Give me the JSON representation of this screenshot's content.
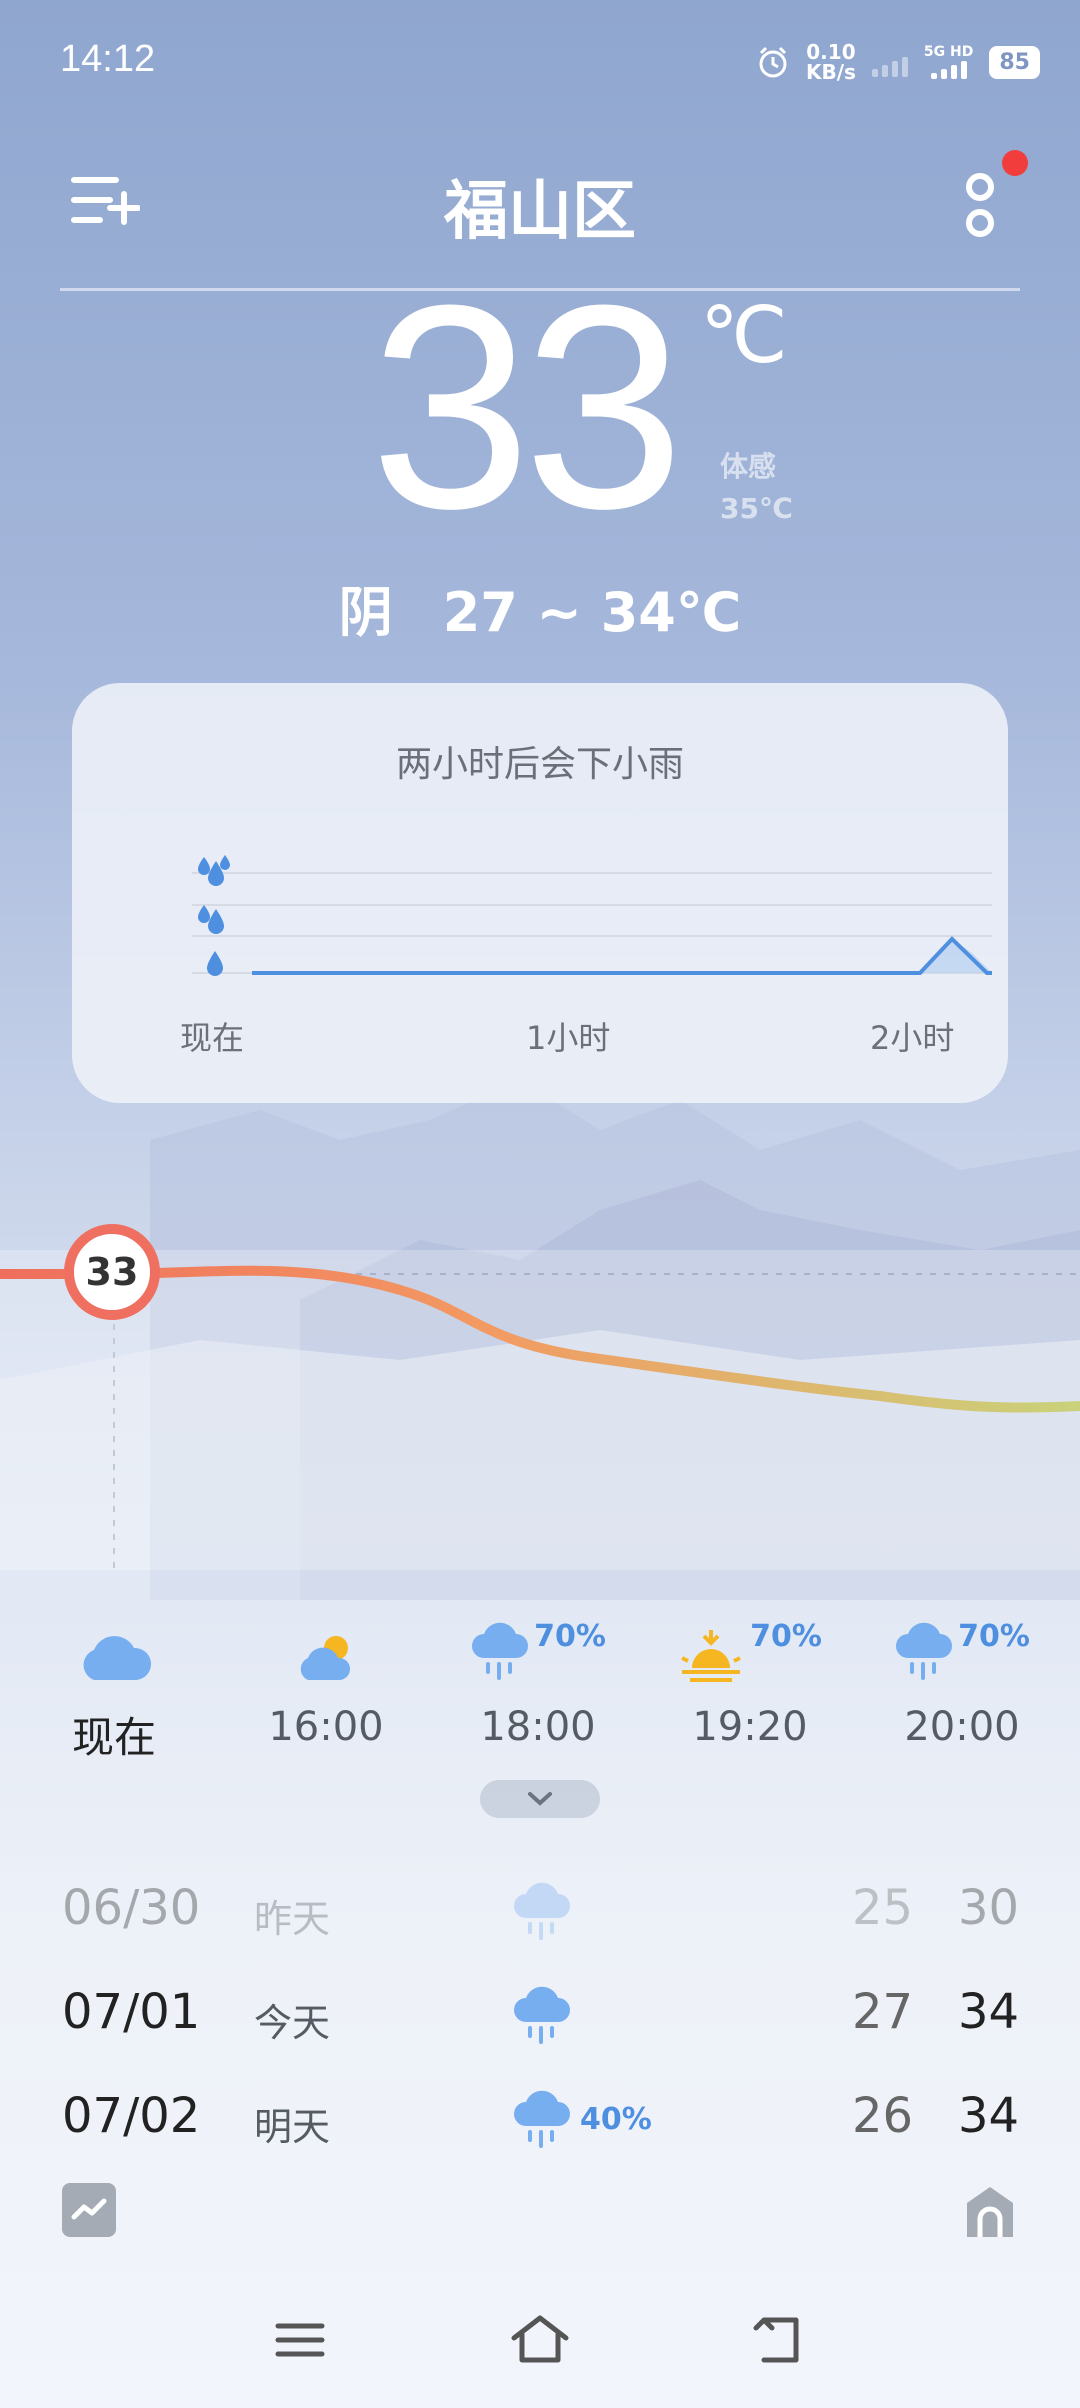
{
  "status_bar": {
    "time": "14:12",
    "net_speed_value": "0.10",
    "net_speed_unit": "KB/s",
    "network_label": "5G HD",
    "battery": "85"
  },
  "header": {
    "city": "福山区"
  },
  "current": {
    "temperature": "33",
    "unit": "℃",
    "feels_like_label": "体感",
    "feels_like_value": "35℃",
    "condition": "阴",
    "range": "27 ~ 34℃"
  },
  "rain_card": {
    "title": "两小时后会下小雨",
    "x_labels": [
      "现在",
      "1小时",
      "2小时"
    ]
  },
  "hourly": {
    "current_temp": "33",
    "items": [
      {
        "time": "现在",
        "icon": "cloud-icon",
        "precip": ""
      },
      {
        "time": "16:00",
        "icon": "partly-cloudy-icon",
        "precip": ""
      },
      {
        "time": "18:00",
        "icon": "rain-cloud-icon",
        "precip": "70%"
      },
      {
        "time": "19:20",
        "icon": "sunset-icon",
        "precip": "70%"
      },
      {
        "time": "20:00",
        "icon": "rain-cloud-icon",
        "precip": "70%"
      }
    ]
  },
  "daily": [
    {
      "date": "06/30",
      "name": "昨天",
      "icon": "rain-cloud-icon",
      "precip": "",
      "low": "25",
      "high": "30"
    },
    {
      "date": "07/01",
      "name": "今天",
      "icon": "rain-cloud-icon",
      "precip": "",
      "low": "27",
      "high": "34"
    },
    {
      "date": "07/02",
      "name": "明天",
      "icon": "rain-cloud-icon",
      "precip": "40%",
      "low": "26",
      "high": "34"
    }
  ],
  "colors": {
    "accent_blue": "#4f8fe0",
    "hot_curve": "#ef7060",
    "mild_curve": "#c9d27a",
    "notification_dot": "#f23d3d"
  }
}
